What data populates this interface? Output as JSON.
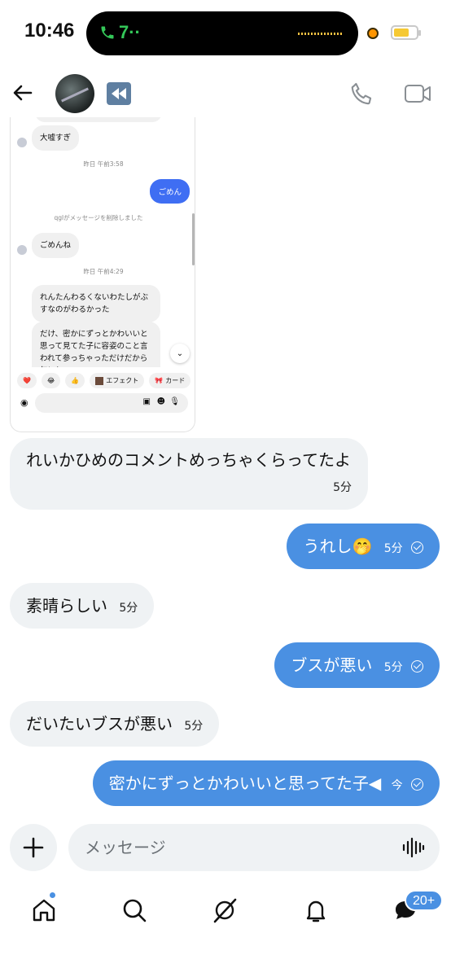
{
  "status_bar": {
    "time": "10:46",
    "call_label": "7··",
    "battery_level": 0.7
  },
  "header": {
    "back_icon": "arrow-left-icon",
    "rewind_icon": "rewind-icon",
    "call_icon": "phone-icon",
    "video_icon": "video-camera-icon"
  },
  "embedded": {
    "msg1": "大嘘すぎ",
    "time1": "昨日 午前3:58",
    "sent1": "ごめん",
    "deleted_notice": "qglがメッセージを削除しました",
    "msg2": "ごめんね",
    "time2": "昨日 午前4:29",
    "msg3": "れんたんわるくないわたしがぶすなのがわるかった",
    "msg4": "だけ、密かにずっとかわいいと思って見てた子に容姿のこと言われて参っちゃっただけだから気にし",
    "reactions": [
      "❤️",
      "😂",
      "👍"
    ],
    "effect_label": "エフェクト",
    "card_label": "カード"
  },
  "messages": [
    {
      "side": "received",
      "text": "れいかひめのコメントめっちゃくらってたよ",
      "time": "5分"
    },
    {
      "side": "sent",
      "text": "うれし🤭",
      "time": "5分"
    },
    {
      "side": "received",
      "text": "素晴らしい",
      "time": "5分"
    },
    {
      "side": "sent",
      "text": "ブスが悪い",
      "time": "5分"
    },
    {
      "side": "received",
      "text": "だいたいブスが悪い",
      "time": "5分"
    },
    {
      "side": "sent",
      "text": "密かにずっとかわいいと思ってた子◀",
      "time": "今"
    }
  ],
  "composer": {
    "placeholder": "メッセージ"
  },
  "nav": {
    "items": [
      "home-icon",
      "search-icon",
      "grok-icon",
      "bell-icon",
      "messages-icon"
    ],
    "badge": "20+"
  },
  "colors": {
    "accent": "#4a90e2",
    "bubble_received": "#eff2f4"
  }
}
